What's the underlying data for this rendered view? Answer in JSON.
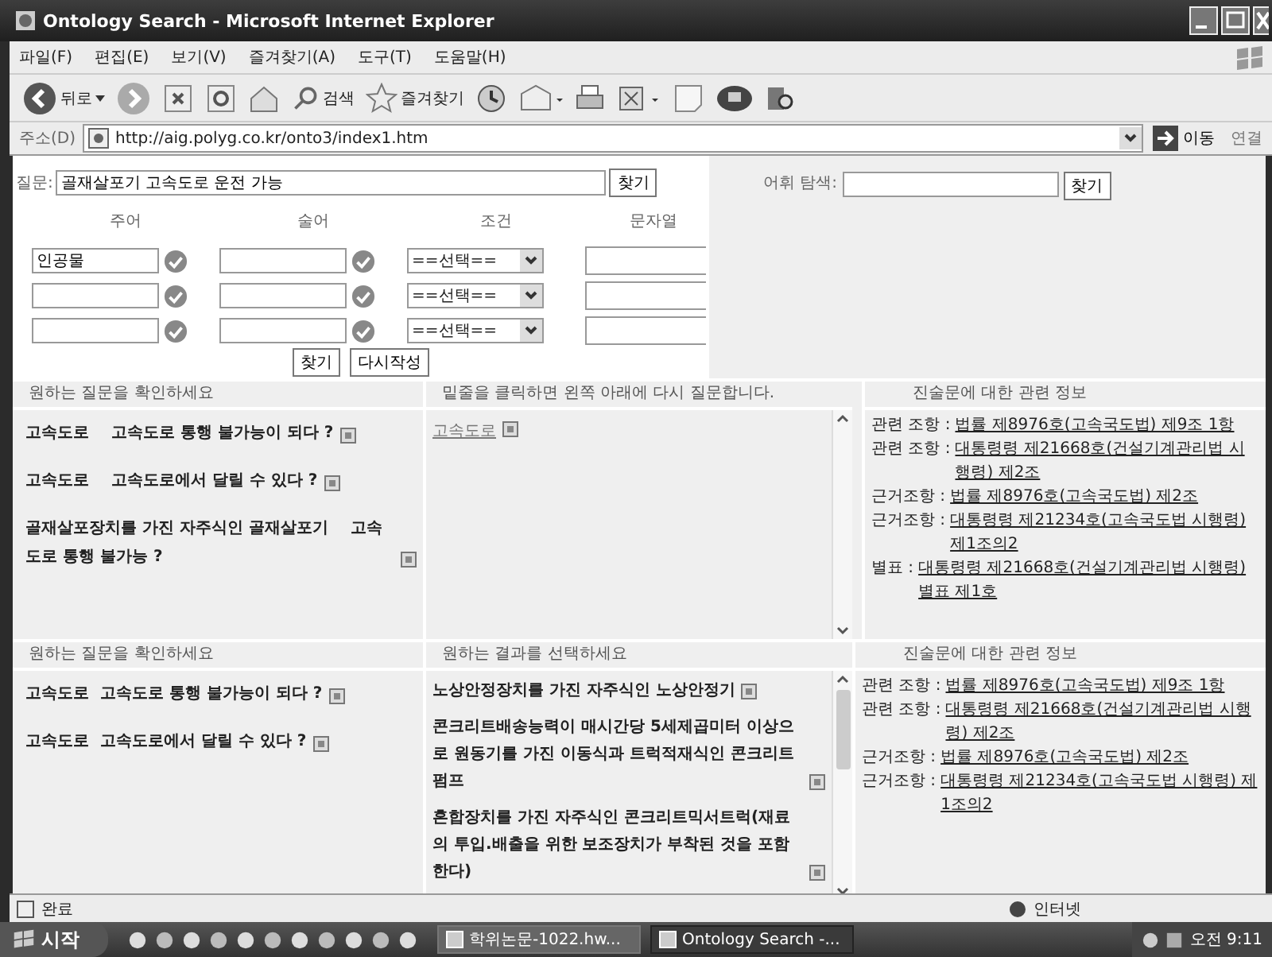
{
  "window": {
    "title": "Ontology Search - Microsoft Internet Explorer"
  },
  "menu": [
    "파일(F)",
    "편집(E)",
    "보기(V)",
    "즐겨찾기(A)",
    "도구(T)",
    "도움말(H)"
  ],
  "toolbar": {
    "back": "뒤로",
    "search": "검색",
    "favorites": "즐겨찾기"
  },
  "address": {
    "label": "주소(D)",
    "url": "http://aig.polyg.co.kr/onto3/index1.htm",
    "go": "이동",
    "links": "연결"
  },
  "query": {
    "label": "질문:",
    "value": "골재살포기 고속도로 운전 가능",
    "button": "찾기"
  },
  "lexicon": {
    "label": "어휘 탐색:",
    "button": "찾기"
  },
  "builder": {
    "headers": [
      "주어",
      "술어",
      "조건",
      "문자열"
    ],
    "rows": [
      {
        "subject": "인공물",
        "condition": "==선택=="
      },
      {
        "condition": "==선택=="
      },
      {
        "condition": "==선택=="
      }
    ],
    "buttons": [
      "찾기",
      "다시작성"
    ]
  },
  "panel_rows": [
    [
      {
        "kind": "questions",
        "header": "원하는 질문을 확인하세요",
        "items": [
          "고속도로    고속도로 통행 불가능이 되다 ?",
          "고속도로    고속도로에서 달릴 수 있다 ?",
          "골재살포장치를 가진 자주식인 골재살포기    고속도로 통행 불가능 ?"
        ]
      },
      {
        "kind": "links",
        "header": "밑줄을 클릭하면 왼쪽 아래에 다시 질문합니다.",
        "items": [
          "고속도로"
        ]
      },
      {
        "kind": "info",
        "header": "진술문에 대한 관련 정보",
        "items": [
          {
            "label": "관련 조항 :",
            "link": "법률 제8976호(고속국도법) 제9조 1항"
          },
          {
            "label": "관련 조항 :",
            "link": "대통령령 제21668호(건설기계관리법 시행령) 제2조"
          },
          {
            "label": "근거조항 :",
            "link": "법률 제8976호(고속국도법) 제2조"
          },
          {
            "label": "근거조항 :",
            "link": "대통령령 제21234호(고속국도법 시행령) 제1조의2"
          },
          {
            "label": "별표 :",
            "link": "대통령령 제21668호(건설기계관리법 시행령) 별표 제1호"
          }
        ]
      }
    ],
    [
      {
        "kind": "questions",
        "header": "원하는 질문을 확인하세요",
        "items": [
          "고속도로  고속도로 통행 불가능이 되다 ?",
          "고속도로  고속도로에서 달릴 수 있다 ?"
        ]
      },
      {
        "kind": "results",
        "header": "원하는 결과를 선택하세요",
        "items": [
          "노상안정장치를 가진 자주식인 노상안정기",
          "콘크리트배송능력이 매시간당 5세제곱미터 이상으로 원동기를 가진 이동식과 트럭적재식인 콘크리트펌프",
          "혼합장치를 가진 자주식인 콘크리트믹서트럭(재료의 투입.배출을 위한 보조장치가 부착된 것을 포함한다)"
        ]
      },
      {
        "kind": "info",
        "header": "진술문에 대한 관련 정보",
        "items": [
          {
            "label": "관련 조항 :",
            "link": "법률 제8976호(고속국도법) 제9조 1항"
          },
          {
            "label": "관련 조항 :",
            "link": "대통령령 제21668호(건설기계관리법 시행령) 제2조"
          },
          {
            "label": "근거조항 :",
            "link": "법률 제8976호(고속국도법) 제2조"
          },
          {
            "label": "근거조항 :",
            "link": "대통령령 제21234호(고속국도법 시행령) 제1조의2"
          }
        ]
      }
    ]
  ],
  "status_bar": {
    "text": "완료",
    "zone": "인터넷"
  },
  "taskbar": {
    "start": "시작",
    "tasks": [
      {
        "label": "학위논문-1022.hw...",
        "selected": false
      },
      {
        "label": "Ontology Search -...",
        "selected": true
      }
    ],
    "clock": "오전 9:11"
  }
}
